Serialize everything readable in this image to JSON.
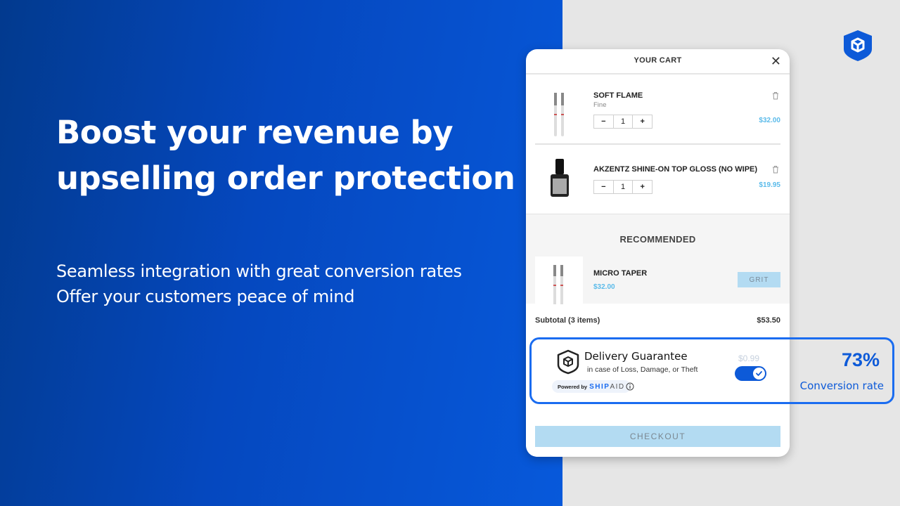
{
  "hero": {
    "headline_line1": "Boost your revenue by",
    "headline_line2": "upselling order protection",
    "sub_line1": "Seamless integration with great conversion rates",
    "sub_line2": "Offer your customers peace of mind"
  },
  "brand": {
    "logo_icon": "shipaid-shield-icon",
    "accent_color": "#1a6cf0"
  },
  "cart": {
    "title": "YOUR CART",
    "close_icon": "close-icon",
    "items": [
      {
        "name": "SOFT FLAME",
        "variant": "Fine",
        "quantity": "1",
        "minus": "−",
        "plus": "+",
        "price": "$32.00",
        "image": "nail-drill-bits"
      },
      {
        "name": "AKZENTZ SHINE-ON TOP GLOSS (NO WIPE)",
        "variant": "",
        "quantity": "1",
        "minus": "−",
        "plus": "+",
        "price": "$19.95",
        "image": "gloss-bottle"
      }
    ],
    "recommended": {
      "title": "RECOMMENDED",
      "item": {
        "name": "MICRO TAPER",
        "price": "$32.00",
        "button_label": "GRIT",
        "image": "nail-drill-bits"
      }
    },
    "subtotal": {
      "label": "Subtotal (3 items)",
      "value": "$53.50"
    },
    "checkout_label": "CHECKOUT"
  },
  "guarantee": {
    "title": "Delivery Guarantee",
    "subtitle": "in case of Loss, Damage, or Theft",
    "price": "$0.99",
    "toggle_on": true,
    "powered_by": "Powered by",
    "brand_ship": "SHIP",
    "brand_aid": "AID",
    "info_icon": "info-icon"
  },
  "stats": {
    "value": "73%",
    "label": "Conversion rate"
  },
  "colors": {
    "price_blue": "#5bbbea",
    "checkout_bg": "#b3dbf2",
    "primary_blue": "#0d5ad8"
  }
}
